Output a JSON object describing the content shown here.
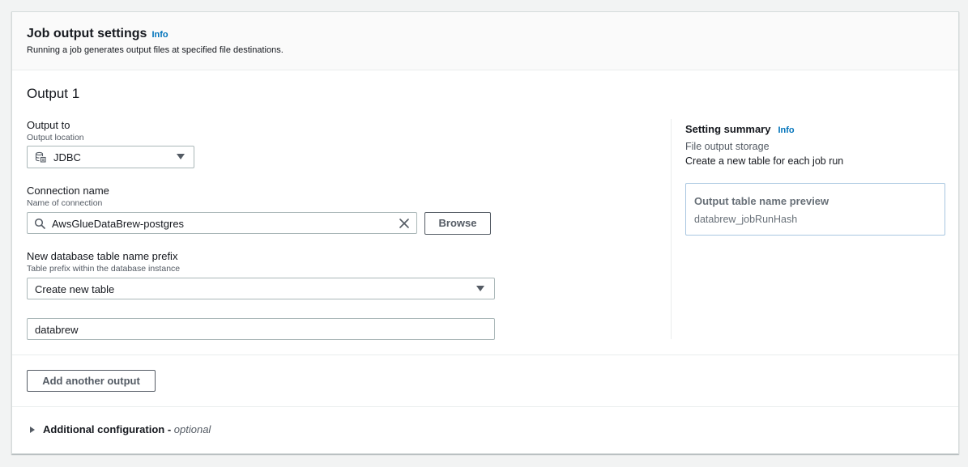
{
  "header": {
    "title": "Job output settings",
    "info": "Info",
    "description": "Running a job generates output files at specified file destinations."
  },
  "output": {
    "title": "Output 1",
    "output_to": {
      "label": "Output to",
      "description": "Output location",
      "value": "JDBC"
    },
    "connection": {
      "label": "Connection name",
      "description": "Name of connection",
      "value": "AwsGlueDataBrew-postgres",
      "browse_label": "Browse"
    },
    "table_prefix": {
      "label": "New database table name prefix",
      "description": "Table prefix within the database instance",
      "select_value": "Create new table",
      "input_value": "databrew"
    }
  },
  "summary": {
    "title": "Setting summary",
    "info": "Info",
    "storage_label": "File output storage",
    "storage_value": "Create a new table for each job run",
    "preview_title": "Output table name preview",
    "preview_value": "databrew_jobRunHash"
  },
  "actions": {
    "add_output_label": "Add another output"
  },
  "additional": {
    "label": "Additional configuration -",
    "optional": "optional"
  },
  "colors": {
    "accent": "#0073bb",
    "border": "#aab7b8",
    "text": "#16191f"
  }
}
